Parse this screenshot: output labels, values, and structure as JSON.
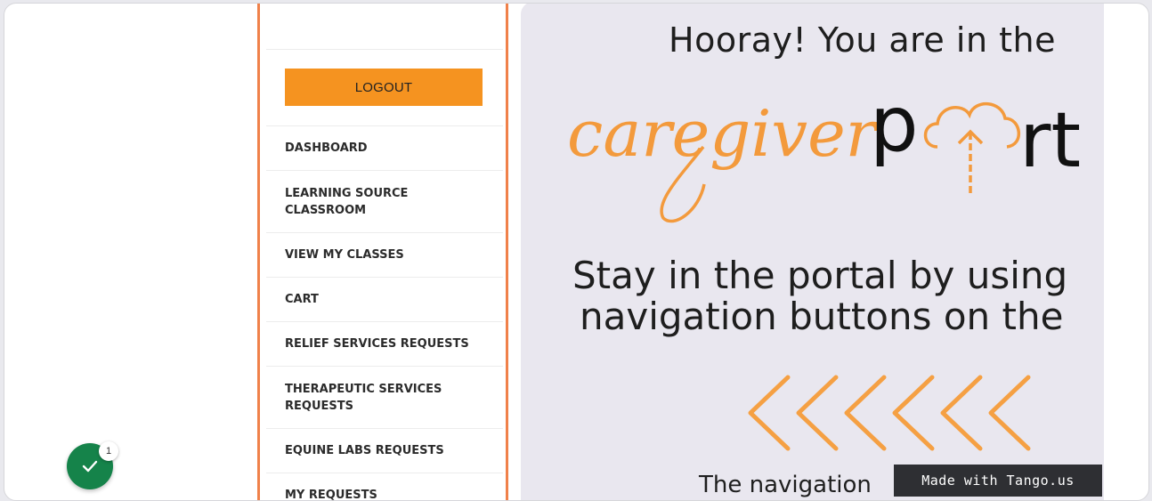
{
  "sidebar": {
    "logout_label": "LOGOUT",
    "items": [
      {
        "line1": "DASHBOARD",
        "line2": ""
      },
      {
        "line1": "LEARNING SOURCE",
        "line2": "CLASSROOM"
      },
      {
        "line1": "VIEW MY CLASSES",
        "line2": ""
      },
      {
        "line1": "CART",
        "line2": ""
      },
      {
        "line1": "RELIEF SERVICES REQUESTS",
        "line2": ""
      },
      {
        "line1": "THERAPEUTIC SERVICES",
        "line2": "REQUESTS"
      },
      {
        "line1": "EQUINE LABS REQUESTS",
        "line2": ""
      },
      {
        "line1": "MY REQUESTS",
        "line2": ""
      }
    ]
  },
  "content": {
    "hooray": "Hooray! You are in the",
    "logo_script": "caregiver",
    "logo_word_start": "p",
    "logo_word_end": "rt",
    "stay_line1": "Stay in the portal by using",
    "stay_line2": "navigation buttons on the",
    "bottom_text": "The navigation"
  },
  "watermark": "Made with Tango.us",
  "fab": {
    "badge_count": "1",
    "icon": "check-icon"
  },
  "colors": {
    "accent_orange": "#f59320",
    "sidebar_border": "#f0814a",
    "logo_orange": "#f39a3c",
    "panel_bg": "#e9e7ef",
    "fab_green": "#15834a"
  }
}
